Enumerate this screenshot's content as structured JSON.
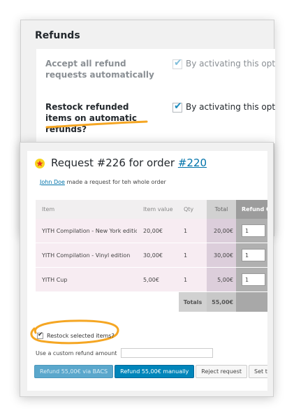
{
  "settings": {
    "title": "Refunds",
    "rows": [
      {
        "label": "Accept all refund requests automatically",
        "checked": true,
        "disabled": true,
        "description": "By activating this option"
      },
      {
        "label": "Restock refunded items on automatic refunds?",
        "checked": true,
        "disabled": false,
        "description": "By activating this option"
      }
    ]
  },
  "request": {
    "title_prefix": "Request #226 for order ",
    "order_link": "#220",
    "customer_name": "John Doe",
    "subtitle_rest": " made a request for teh whole order",
    "table": {
      "headers": [
        "Item",
        "Item value",
        "Qty",
        "Total",
        "Refund Qty"
      ],
      "rows": [
        {
          "item": "YITH Compilation - New York edition",
          "value": "20,00€",
          "qty": "1",
          "total": "20,00€",
          "refund_qty": "1"
        },
        {
          "item": "YITH Compilation - Vinyl edition",
          "value": "30,00€",
          "qty": "1",
          "total": "30,00€",
          "refund_qty": "1"
        },
        {
          "item": "YITH Cup",
          "value": "5,00€",
          "qty": "1",
          "total": "5,00€",
          "refund_qty": "1"
        }
      ],
      "totals_label": "Totals",
      "totals_value": "55,00€"
    },
    "restock_label": "Restock selected items?",
    "restock_checked": true,
    "custom_amount_label": "Use a custom refund amount",
    "custom_amount_value": "",
    "buttons": {
      "refund_bacs": "Refund 55,00€ via BACS",
      "refund_manual": "Refund 55,00€ manually",
      "reject": "Reject request",
      "processing": "Set to processing"
    }
  },
  "colors": {
    "accent": "#0073aa",
    "primary_button": "#0085ba",
    "highlight": "#f5a623",
    "star": "#e52d27"
  }
}
